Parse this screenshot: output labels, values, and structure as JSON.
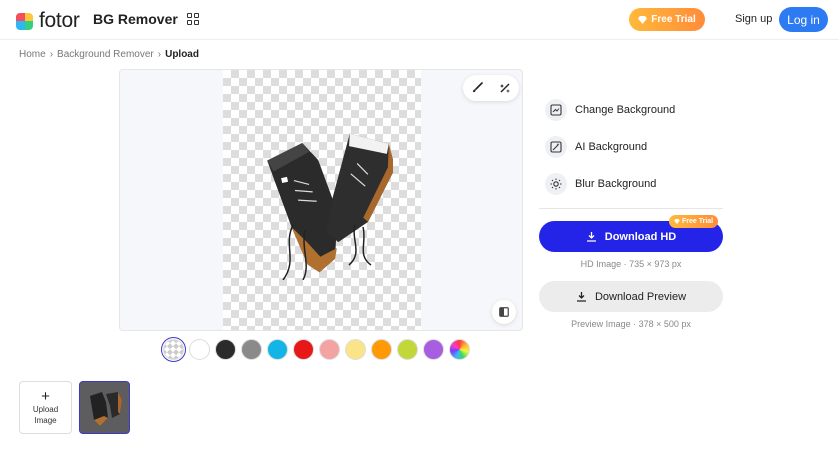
{
  "header": {
    "logo_text": "fotor",
    "product": "BG Remover",
    "free_trial": "Free Trial",
    "signup": "Sign up",
    "login": "Log in"
  },
  "breadcrumb": [
    "Home",
    "Background Remover",
    "Upload"
  ],
  "side_menu": [
    {
      "label": "Change Background",
      "icon": "change-background-icon"
    },
    {
      "label": "AI Background",
      "icon": "ai-background-icon"
    },
    {
      "label": "Blur Background",
      "icon": "blur-background-icon"
    }
  ],
  "download_hd": {
    "label": "Download HD",
    "badge": "Free Trial",
    "note": "HD Image · 735 × 973 px"
  },
  "download_preview": {
    "label": "Download Preview",
    "note": "Preview Image · 378 × 500 px"
  },
  "swatches": [
    "transparent",
    "#ffffff",
    "#2b2b2b",
    "#8a8a8a",
    "#12b5e6",
    "#e81818",
    "#f4a3a3",
    "#fbe38a",
    "#ff9a06",
    "#c2d83a",
    "#a85ee0",
    "rainbow"
  ],
  "upload": {
    "label_line1": "Upload",
    "label_line2": "Image"
  },
  "colors": {
    "primary": "#2424e8",
    "login": "#2c7bf2",
    "trial_gradient_start": "#ffb93a",
    "trial_gradient_end": "#ff8c3a"
  }
}
